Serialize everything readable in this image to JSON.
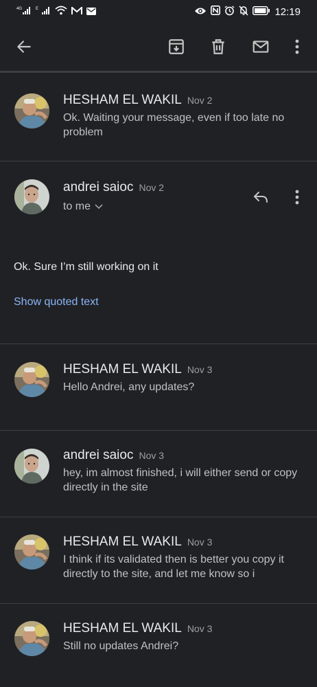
{
  "status_bar": {
    "left_icons": [
      "4G",
      "E",
      "wifi-icon",
      "gmail-icon",
      "mail-icon"
    ],
    "right_icons": [
      "eye-icon",
      "nfc-icon",
      "alarm-icon",
      "bell-off-icon",
      "battery-icon"
    ],
    "time": "12:19"
  },
  "toolbar": {
    "icons": [
      "back-arrow-icon",
      "archive-icon",
      "delete-icon",
      "mark-unread-icon",
      "more-vert-icon"
    ]
  },
  "messages": [
    {
      "sender": "HESHAM EL WAKIL",
      "date": "Nov 2",
      "snippet": "Ok. Waiting your message, even if too late no problem"
    },
    {
      "sender": "andrei saioc",
      "date": "Nov 2",
      "recipient": "to me",
      "body": "Ok. Sure I’m still working on it",
      "quoted_link": "Show quoted text"
    },
    {
      "sender": "HESHAM EL WAKIL",
      "date": "Nov 3",
      "snippet": "Hello Andrei, any updates?"
    },
    {
      "sender": "andrei saioc",
      "date": "Nov 3",
      "snippet": "hey, im almost finished, i will either send or copy directly in the site"
    },
    {
      "sender": "HESHAM EL WAKIL",
      "date": "Nov 3",
      "snippet": "I think if its validated then is better you copy it directly to the site, and let me know so i"
    },
    {
      "sender": "HESHAM EL WAKIL",
      "date": "Nov 3",
      "snippet": "Still no updates Andrei?"
    }
  ],
  "colors": {
    "background": "#202124",
    "divider": "#3c4043",
    "primary_text": "#e8eaed",
    "secondary_text": "#bdc1c6",
    "date_text": "#9aa0a6",
    "link": "#8ab4f8"
  }
}
